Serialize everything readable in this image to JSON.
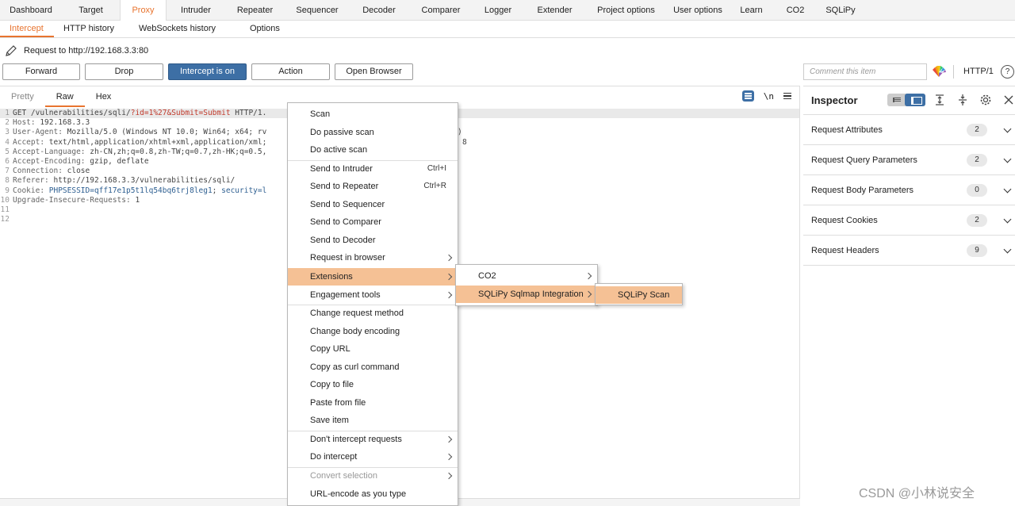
{
  "top_tabs": [
    "Dashboard",
    "Target",
    "Proxy",
    "Intruder",
    "Repeater",
    "Sequencer",
    "Decoder",
    "Comparer",
    "Logger",
    "Extender",
    "Project options",
    "User options",
    "Learn",
    "CO2",
    "SQLiPy"
  ],
  "top_tab_active": "Proxy",
  "sub_tabs": [
    "Intercept",
    "HTTP history",
    "WebSockets history",
    "Options"
  ],
  "request_line": "Request to http://192.168.3.3:80",
  "toolbar": {
    "forward": "Forward",
    "drop": "Drop",
    "intercept": "Intercept is on",
    "action": "Action",
    "open_browser": "Open Browser",
    "comment_placeholder": "Comment this item",
    "http_version": "HTTP/1",
    "help": "?"
  },
  "editor_tabs": [
    "Pretty",
    "Raw",
    "Hex"
  ],
  "editor_active_tab": "Raw",
  "newline_label": "\\n",
  "code_lines": [
    {
      "n": "1",
      "parts": [
        [
          "k",
          "GET "
        ],
        [
          "k",
          "/vulnerabilities/sqli/"
        ],
        [
          "u",
          "?id=1%27&Submit=Submit"
        ],
        [
          "k",
          " HTTP/1."
        ]
      ]
    },
    {
      "n": "2",
      "parts": [
        [
          "h",
          "Host: "
        ],
        [
          "k",
          "192.168.3.3"
        ]
      ]
    },
    {
      "n": "3",
      "parts": [
        [
          "h",
          "User-Agent: "
        ],
        [
          "k",
          "Mozilla/5.0 (Windows NT 10.0; Win64; x64; rv"
        ]
      ]
    },
    {
      "n": "4",
      "parts": [
        [
          "h",
          "Accept: "
        ],
        [
          "k",
          "text/html,application/xhtml+xml,application/xml;"
        ]
      ]
    },
    {
      "n": "5",
      "parts": [
        [
          "h",
          "Accept-Language: "
        ],
        [
          "k",
          "zh-CN,zh;q=0.8,zh-TW;q=0.7,zh-HK;q=0.5,"
        ]
      ]
    },
    {
      "n": "6",
      "parts": [
        [
          "h",
          "Accept-Encoding: "
        ],
        [
          "k",
          "gzip, deflate"
        ]
      ]
    },
    {
      "n": "7",
      "parts": [
        [
          "h",
          "Connection: "
        ],
        [
          "k",
          "close"
        ]
      ]
    },
    {
      "n": "8",
      "parts": [
        [
          "h",
          "Referer: "
        ],
        [
          "k",
          "http://192.168.3.3/vulnerabilities/sqli/"
        ]
      ]
    },
    {
      "n": "9",
      "parts": [
        [
          "h",
          "Cookie: "
        ],
        [
          "v",
          "PHPSESSID=qff17e1p5t1lq54bq6trj8leg1"
        ],
        [
          "k",
          "; "
        ],
        [
          "v",
          "security=l"
        ]
      ]
    },
    {
      "n": "10",
      "parts": [
        [
          "h",
          "Upgrade-Insecure-Requests: "
        ],
        [
          "k",
          "1"
        ]
      ]
    },
    {
      "n": "11",
      "parts": []
    },
    {
      "n": "12",
      "parts": []
    }
  ],
  "code_overflow": [
    {
      "line": 3,
      "text": ")"
    },
    {
      "line": 4,
      "text": "8"
    }
  ],
  "inspector": {
    "title": "Inspector",
    "rows": [
      {
        "label": "Request Attributes",
        "count": "2"
      },
      {
        "label": "Request Query Parameters",
        "count": "2"
      },
      {
        "label": "Request Body Parameters",
        "count": "0"
      },
      {
        "label": "Request Cookies",
        "count": "2"
      },
      {
        "label": "Request Headers",
        "count": "9"
      }
    ]
  },
  "context_menu": [
    {
      "label": "Scan"
    },
    {
      "label": "Do passive scan"
    },
    {
      "label": "Do active scan"
    },
    {
      "sep": true
    },
    {
      "label": "Send to Intruder",
      "shortcut": "Ctrl+I"
    },
    {
      "label": "Send to Repeater",
      "shortcut": "Ctrl+R"
    },
    {
      "label": "Send to Sequencer"
    },
    {
      "label": "Send to Comparer"
    },
    {
      "label": "Send to Decoder"
    },
    {
      "label": "Request in browser",
      "submenu": true
    },
    {
      "sep": true
    },
    {
      "label": "Extensions",
      "submenu": true,
      "selected": true
    },
    {
      "label": "Engagement tools",
      "submenu": true
    },
    {
      "sep": true
    },
    {
      "label": "Change request method"
    },
    {
      "label": "Change body encoding"
    },
    {
      "label": "Copy URL"
    },
    {
      "label": "Copy as curl command"
    },
    {
      "label": "Copy to file"
    },
    {
      "label": "Paste from file"
    },
    {
      "label": "Save item"
    },
    {
      "sep": true
    },
    {
      "label": "Don't intercept requests",
      "submenu": true
    },
    {
      "label": "Do intercept",
      "submenu": true
    },
    {
      "sep": true
    },
    {
      "label": "Convert selection",
      "submenu": true,
      "disabled": true
    },
    {
      "label": "URL-encode as you type"
    }
  ],
  "extensions_menu": [
    {
      "label": "CO2",
      "submenu": true
    },
    {
      "label": "SQLiPy Sqlmap Integration",
      "submenu": true,
      "selected": true
    }
  ],
  "sqlipy_menu": [
    {
      "label": "SQLiPy Scan",
      "selected": true
    }
  ],
  "watermark": "CSDN @小林说安全",
  "colors": {
    "accent": "#e8742f",
    "intercept_on": "#3d6fa5",
    "menu_selected": "#f5c195"
  }
}
